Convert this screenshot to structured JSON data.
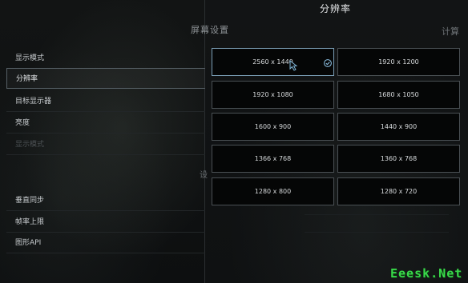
{
  "left_panel": {
    "header": "屏幕设置",
    "partial_letter": "设",
    "items": [
      {
        "label": "显示模式"
      },
      {
        "label": "分辨率"
      },
      {
        "label": "目标显示器"
      },
      {
        "label": "亮度"
      },
      {
        "label": "垂直同步"
      },
      {
        "label": "帧率上限"
      },
      {
        "label": "图形API"
      }
    ],
    "disabled_item": {
      "label": "显示模式"
    }
  },
  "right_panel_ghost_header": "计算",
  "resolution_panel": {
    "title": "分辨率",
    "options": [
      {
        "label": "2560 x 1440",
        "selected": true
      },
      {
        "label": "1920 x 1200",
        "selected": false
      },
      {
        "label": "1920 x 1080",
        "selected": false
      },
      {
        "label": "1680 x 1050",
        "selected": false
      },
      {
        "label": "1600 x 900",
        "selected": false
      },
      {
        "label": "1440 x 900",
        "selected": false
      },
      {
        "label": "1366 x 768",
        "selected": false
      },
      {
        "label": "1360 x 768",
        "selected": false
      },
      {
        "label": "1280 x 800",
        "selected": false
      },
      {
        "label": "1280 x 720",
        "selected": false
      }
    ]
  },
  "watermark": "Eeesk.Net",
  "colors": {
    "selected_border": "#7b9fb6",
    "check": "#8fc3e6",
    "watermark": "#39d84a"
  },
  "icons": {
    "check": "check-icon",
    "cursor": "cursor-arrow-icon"
  }
}
